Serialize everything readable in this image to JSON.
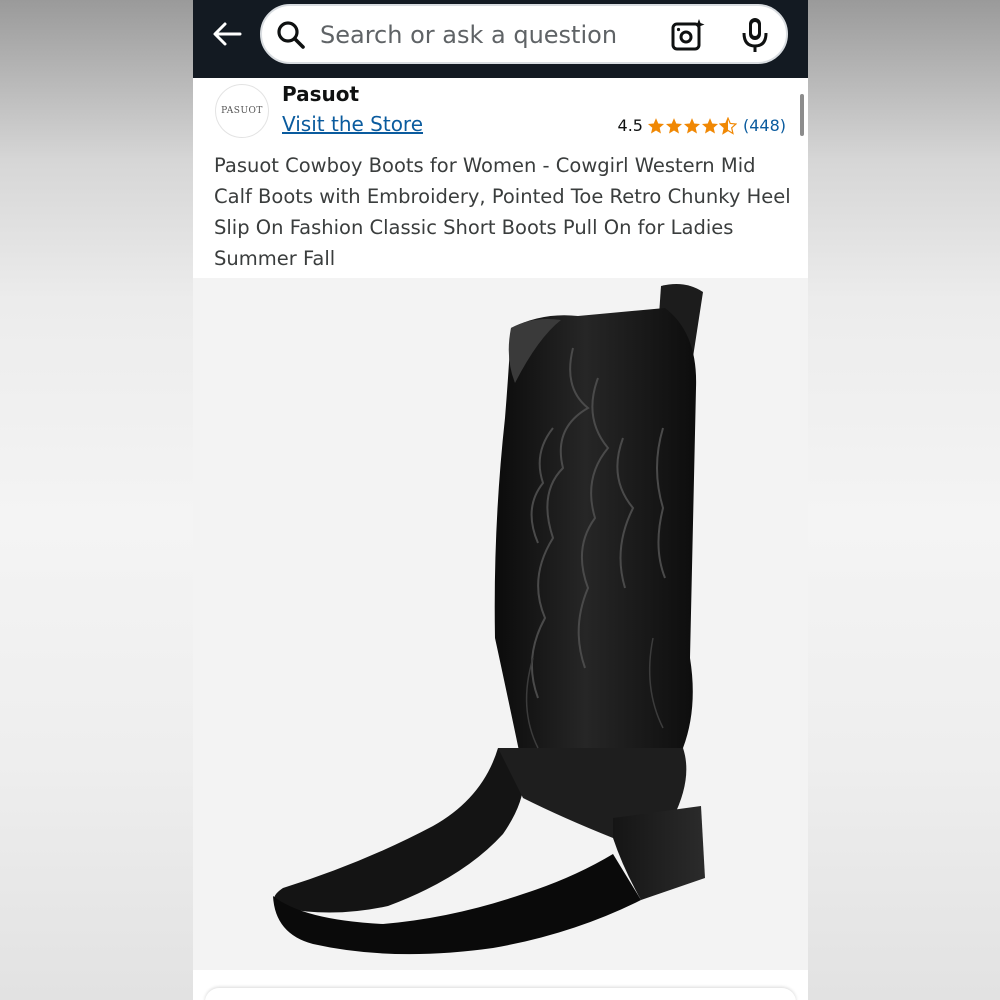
{
  "search": {
    "placeholder": "Search or ask a question",
    "icons": [
      "back-arrow-icon",
      "search-icon",
      "camera-lens-icon",
      "microphone-icon"
    ]
  },
  "store": {
    "name": "Pasuot",
    "logo_text": "PASUOT",
    "visit_label": "Visit the Store"
  },
  "rating": {
    "value": "4.5",
    "stars": 4.5,
    "count": "(448)",
    "star_color": "#f08804"
  },
  "product": {
    "title": "Pasuot Cowboy Boots for Women - Cowgirl Western Mid Calf Boots with Embroidery, Pointed Toe Retro Chunky Heel Slip On Fashion Classic Short Boots Pull On for Ladies Summer Fall"
  },
  "colors": {
    "topbar": "#131a22",
    "link": "#0a5b9e",
    "text": "#0f1111"
  }
}
